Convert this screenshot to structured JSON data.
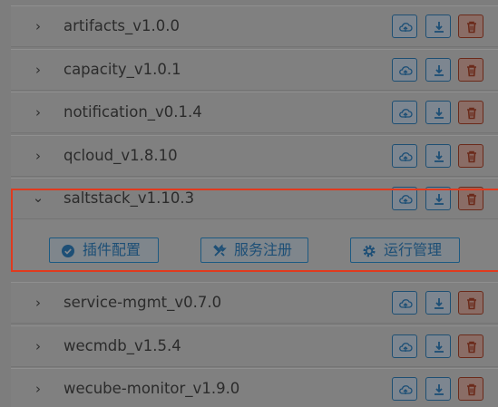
{
  "plugins": [
    {
      "name": "artifacts_v1.0.0",
      "expanded": false
    },
    {
      "name": "capacity_v1.0.1",
      "expanded": false
    },
    {
      "name": "notification_v0.1.4",
      "expanded": false
    },
    {
      "name": "qcloud_v1.8.10",
      "expanded": false
    },
    {
      "name": "saltstack_v1.10.3",
      "expanded": true
    },
    {
      "name": "service-mgmt_v0.7.0",
      "expanded": false
    },
    {
      "name": "wecmdb_v1.5.4",
      "expanded": false
    },
    {
      "name": "wecube-monitor_v1.9.0",
      "expanded": false
    }
  ],
  "expanded_actions": {
    "plugin_config": "插件配置",
    "service_registration": "服务注册",
    "runtime_management": "运行管理"
  },
  "icons": {
    "collapsed": "chevron-right-icon",
    "expanded": "chevron-down-icon",
    "upload": "cloud-upload-icon",
    "download": "download-icon",
    "delete": "trash-icon"
  },
  "colors": {
    "primary": "#1d4f76",
    "danger": "#6b2a1a",
    "highlight": "#e03a1e"
  }
}
